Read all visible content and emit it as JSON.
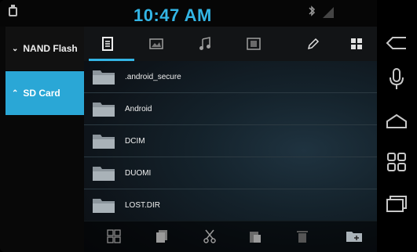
{
  "statusbar": {
    "time": "10:47 AM",
    "bluetooth_glyph": "ʙ"
  },
  "drives": [
    {
      "label": "NAND Flash",
      "expanded": false,
      "chevron": "v"
    },
    {
      "label": "SD Card",
      "expanded": true,
      "chevron": "^"
    }
  ],
  "tabs": [
    {
      "icon": "document-icon",
      "active": true
    },
    {
      "icon": "image-icon",
      "active": false
    },
    {
      "icon": "music-icon",
      "active": false
    },
    {
      "icon": "video-icon",
      "active": false
    },
    {
      "icon": "pencil-icon",
      "active": false
    },
    {
      "icon": "grid-view-icon",
      "active": false
    }
  ],
  "files": [
    {
      "name": ".android_secure"
    },
    {
      "name": "Android"
    },
    {
      "name": "DCIM"
    },
    {
      "name": "DUOMI"
    },
    {
      "name": "LOST.DIR"
    }
  ],
  "bottom_toolbar": [
    "select-all-icon",
    "copy-icon",
    "cut-icon",
    "paste-icon",
    "delete-icon",
    "new-folder-icon"
  ],
  "right_nav": [
    "back-icon",
    "microphone-icon",
    "home-icon",
    "apps-grid-icon",
    "recent-apps-icon"
  ],
  "colors": {
    "accent": "#33b5e5",
    "sd_selected": "#2aa7d6"
  }
}
